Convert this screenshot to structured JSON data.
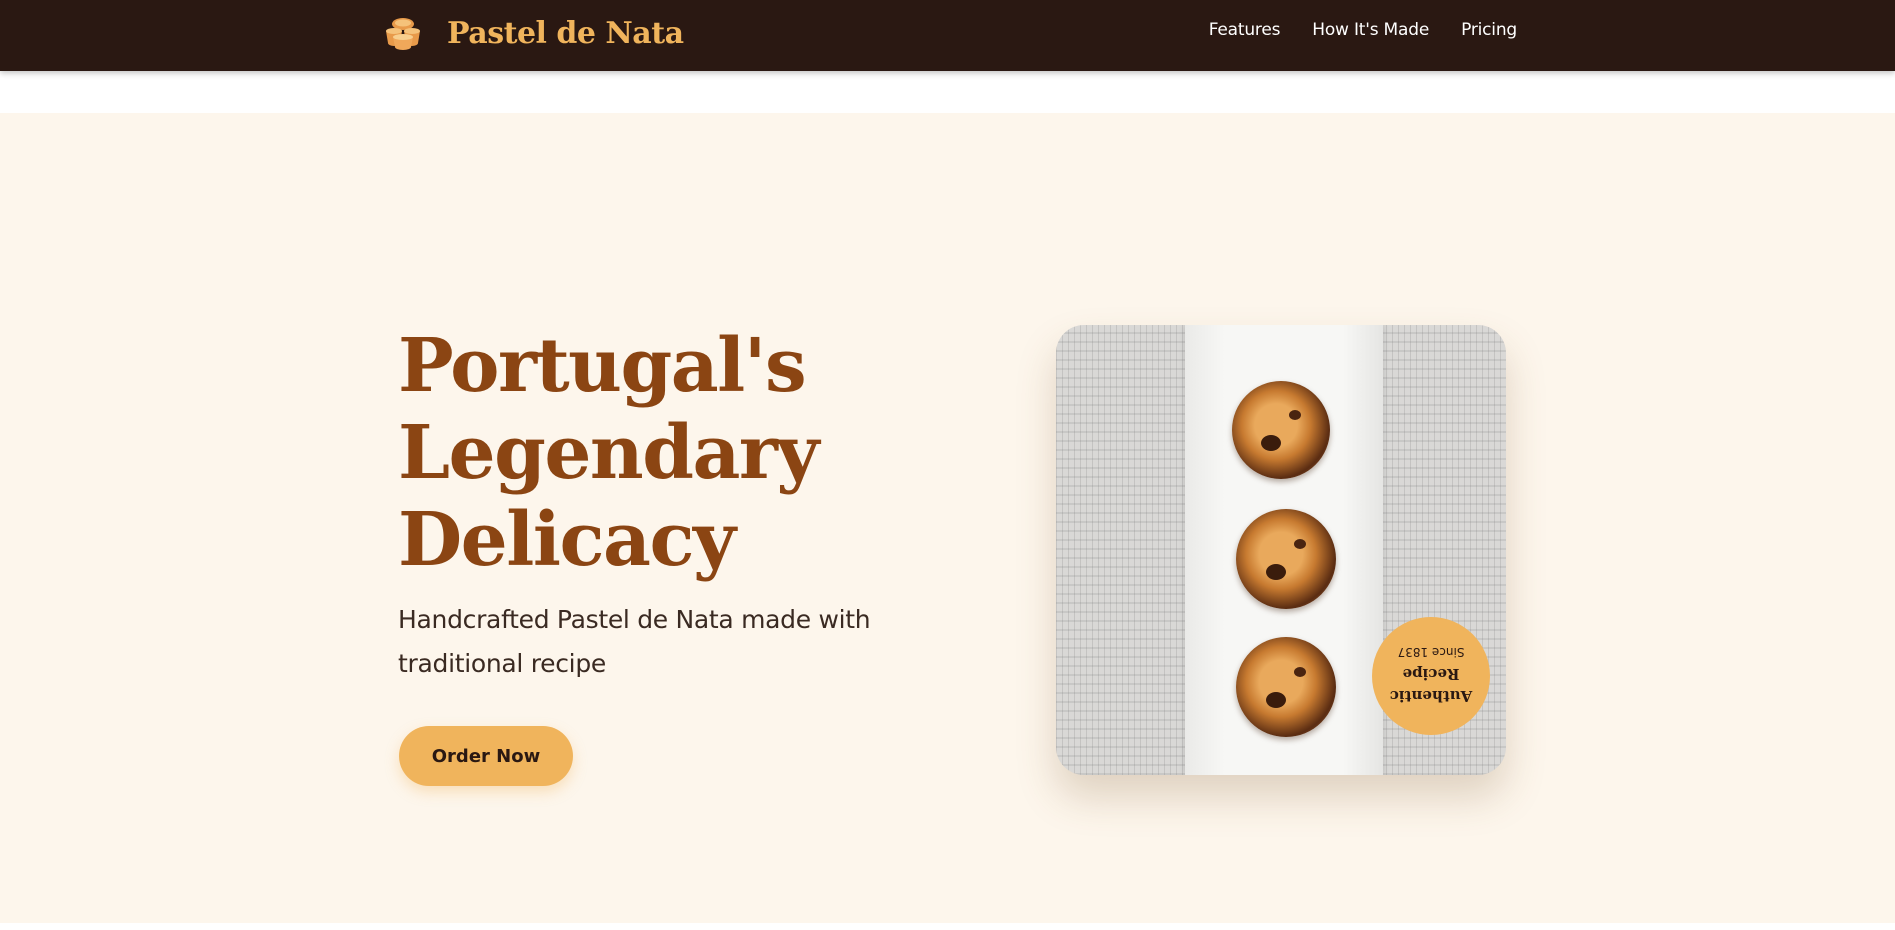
{
  "header": {
    "brand": "Pastel de Nata",
    "logo_icon": "pastry-stack-icon",
    "nav": [
      "Features",
      "How It's Made",
      "Pricing"
    ]
  },
  "hero": {
    "title_lines": [
      "Portugal's",
      "Legendary",
      "Delicacy"
    ],
    "subtitle": "Handcrafted Pastel de Nata made with traditional recipe",
    "cta": "Order Now"
  },
  "badge": {
    "line1": "Authentic",
    "line2": "Recipe",
    "since": "Since 1837"
  },
  "colors": {
    "header_bg": "#2a1812",
    "accent": "#f0b45c",
    "title": "#8b4513",
    "hero_bg": "#fdf6ec"
  }
}
